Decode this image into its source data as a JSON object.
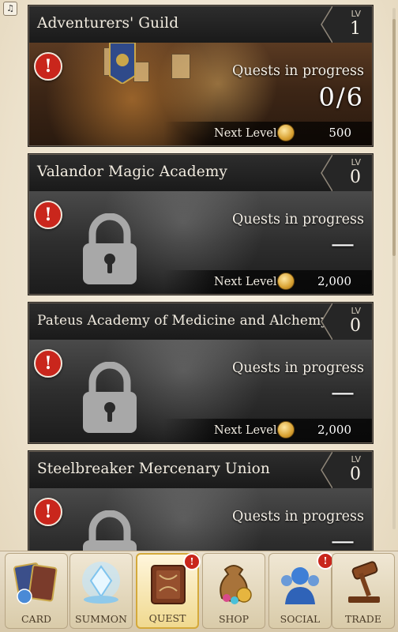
{
  "music_toggle": "♫",
  "guilds": [
    {
      "title": "Adventurers' Guild",
      "lv_label": "LV",
      "level": "1",
      "state": "unlocked",
      "progress_label": "Quests in progress",
      "progress_value": "0/6",
      "next_label": "Next Level",
      "next_cost": "500"
    },
    {
      "title": "Valandor Magic Academy",
      "lv_label": "LV",
      "level": "0",
      "state": "locked",
      "progress_label": "Quests in progress",
      "progress_value": "—",
      "next_label": "Next Level",
      "next_cost": "2,000"
    },
    {
      "title": "Pateus Academy of Medicine and Alchemy",
      "lv_label": "LV",
      "level": "0",
      "state": "locked",
      "progress_label": "Quests in progress",
      "progress_value": "—",
      "next_label": "Next Level",
      "next_cost": "2,000"
    },
    {
      "title": "Steelbreaker Mercenary Union",
      "lv_label": "LV",
      "level": "0",
      "state": "locked",
      "progress_label": "Quests in progress",
      "progress_value": "—"
    }
  ],
  "nav": [
    {
      "label": "CARD",
      "icon": "card-icon",
      "active": false,
      "badge": false
    },
    {
      "label": "SUMMON",
      "icon": "crystal-icon",
      "active": false,
      "badge": false
    },
    {
      "label": "QUEST",
      "icon": "book-icon",
      "active": true,
      "badge": true
    },
    {
      "label": "SHOP",
      "icon": "money-bag-icon",
      "active": false,
      "badge": false
    },
    {
      "label": "SOCIAL",
      "icon": "people-icon",
      "active": false,
      "badge": true
    },
    {
      "label": "TRADE",
      "icon": "gavel-icon",
      "active": false,
      "badge": false
    }
  ],
  "alert_glyph": "!",
  "colors": {
    "alert": "#c9261c",
    "card_bg": "#1d1d1d",
    "active_tab_border": "#d4a93a"
  }
}
